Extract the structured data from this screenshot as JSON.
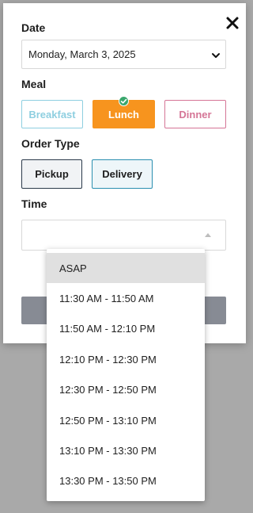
{
  "form": {
    "date_label": "Date",
    "date_value": "Monday, March 3, 2025",
    "meal_label": "Meal",
    "meals": [
      {
        "label": "Breakfast",
        "selected": false
      },
      {
        "label": "Lunch",
        "selected": true
      },
      {
        "label": "Dinner",
        "selected": false
      }
    ],
    "order_type_label": "Order Type",
    "order_types": [
      {
        "label": "Pickup"
      },
      {
        "label": "Delivery"
      }
    ],
    "time_label": "Time",
    "time_value": ""
  },
  "time_dropdown": {
    "options": [
      {
        "label": "ASAP",
        "selected": true
      },
      {
        "label": "11:30 AM - 11:50 AM"
      },
      {
        "label": "11:50 AM - 12:10 PM"
      },
      {
        "label": "12:10 PM - 12:30 PM"
      },
      {
        "label": "12:30 PM - 12:50 PM"
      },
      {
        "label": "12:50 PM - 13:10 PM"
      },
      {
        "label": "13:10 PM - 13:30 PM"
      },
      {
        "label": "13:30 PM - 13:50 PM"
      }
    ]
  },
  "colors": {
    "lunch_accent": "#f7941e",
    "breakfast_accent": "#8ecfe0",
    "dinner_accent": "#d57596",
    "delivery_accent": "#2a8fb0",
    "check_badge": "#3aa76d",
    "submit_button": "#878b94",
    "overlay": "#a9a9a9"
  },
  "icons": {
    "close": "close-icon",
    "date_chevron": "chevron-down-icon",
    "time_caret": "caret-up-icon",
    "lunch_check": "check-icon"
  }
}
